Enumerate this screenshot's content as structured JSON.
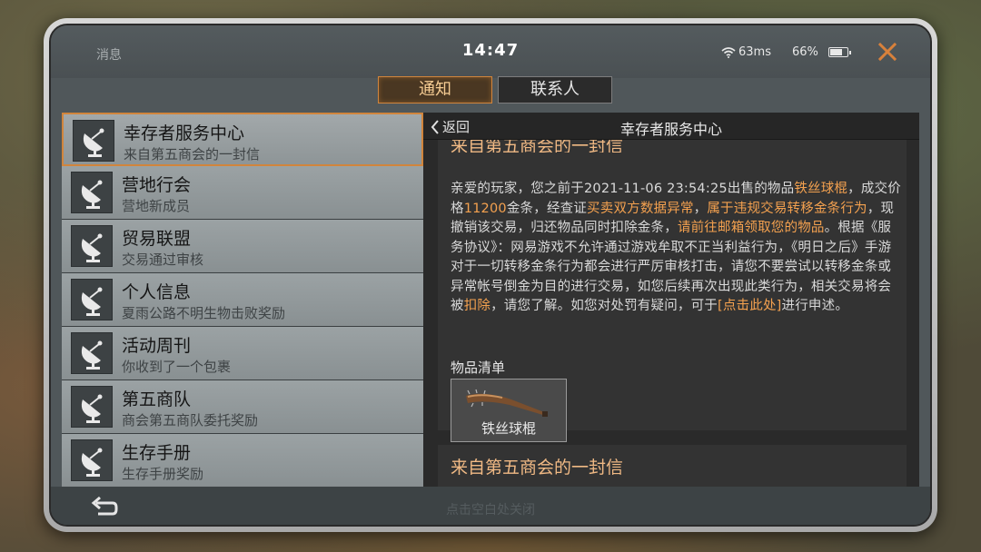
{
  "status": {
    "label": "消息",
    "time": "14:47",
    "ping": "63ms",
    "battery": "66%"
  },
  "tabs": [
    {
      "label": "通知",
      "active": true
    },
    {
      "label": "联系人",
      "active": false
    }
  ],
  "list": [
    {
      "title": "幸存者服务中心",
      "subtitle": "来自第五商会的一封信",
      "active": true
    },
    {
      "title": "营地行会",
      "subtitle": "营地新成员"
    },
    {
      "title": "贸易联盟",
      "subtitle": "交易通过审核"
    },
    {
      "title": "个人信息",
      "subtitle": "夏雨公路不明生物击败奖励"
    },
    {
      "title": "活动周刊",
      "subtitle": "你收到了一个包裹"
    },
    {
      "title": "第五商队",
      "subtitle": "商会第五商队委托奖励"
    },
    {
      "title": "生存手册",
      "subtitle": "生存手册奖励"
    }
  ],
  "panel": {
    "back_label": "返回",
    "title": "幸存者服务中心",
    "mail_subject": "来自第五商会的一封信",
    "body": {
      "p1": "亲爱的玩家，您之前于2021-11-06 23:54:25出售的物品",
      "p1_hl": "铁丝球棍",
      "p2": "，成交价格",
      "p2_hl": "11200",
      "p3": "金条，经查证",
      "p3_hl": "买卖双方数据异常",
      "p4": "，",
      "p4_hl": "属于违规交易转移金条行为",
      "p5": "，现撤销该交易，归还物品同时扣除金条，",
      "p5_hl": "请前往邮箱领取您的物品",
      "p6": "。根据《服务协议》：网易游戏不允许通过游戏牟取不正当利益行为，《明日之后》手游对于一切转移金条行为都会进行严厉审核打击，请您不要尝试以转移金条或异常帐号倒金为目的进行交易，如您后续再次出现此类行为，相关交易将会被",
      "p6_hl": "扣除",
      "p7": "，请您了解。如您对处罚有疑问，可于",
      "p7_hl": "[点击此处]",
      "p8": "进行申述。"
    },
    "items_label": "物品清单",
    "item_name": "铁丝球棍",
    "next_subject": "来自第五商会的一封信"
  },
  "bottom": {
    "hint": "点击空白处关闭"
  },
  "colors": {
    "accent": "#d1853c",
    "highlight": "#f4a14f",
    "subject": "#f0b984"
  },
  "icons": {
    "close": "close-icon",
    "wifi": "wifi-icon",
    "back": "chevron-left-icon",
    "list_item": "satellite-dish-icon",
    "return": "return-arrow-icon",
    "item": "spiked-bat-icon"
  }
}
